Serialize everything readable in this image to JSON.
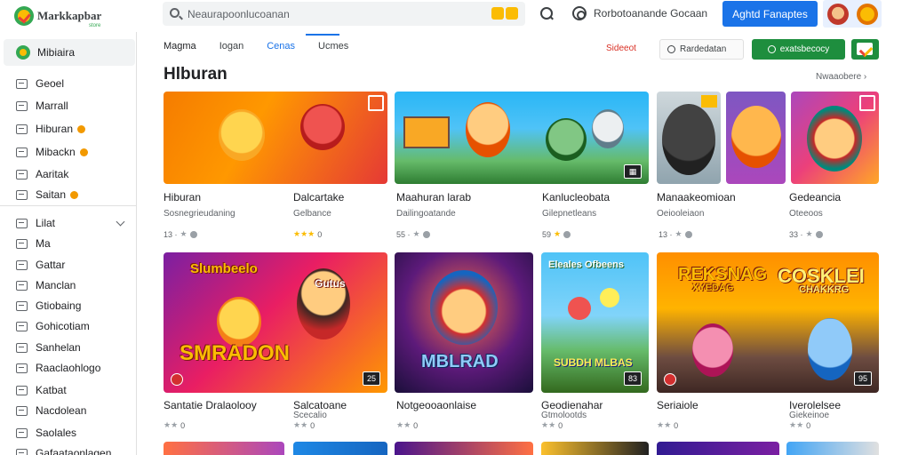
{
  "topbar": {
    "logo_text": "Markkapbar",
    "logo_sub": "store",
    "search_placeholder": "Neaurapoonlucoanan",
    "help_text": "Rorbotoanande Gocaan",
    "signin_label": "Aghtd Fanaptes"
  },
  "sidebar": {
    "home_label": "Mibiaira",
    "items": [
      {
        "label": "Geoel",
        "dot": false
      },
      {
        "label": "Marrall",
        "dot": false
      },
      {
        "label": "Hiburan",
        "dot": true
      },
      {
        "label": "Mibackn",
        "dot": true
      },
      {
        "label": "Aaritak",
        "dot": false
      },
      {
        "label": "Saitan",
        "dot": true
      }
    ],
    "items2": [
      {
        "label": "Lilat"
      },
      {
        "label": "Ma"
      },
      {
        "label": "Gattar"
      },
      {
        "label": "Manclan"
      },
      {
        "label": "Gtiobaing"
      },
      {
        "label": "Gohicotiam"
      },
      {
        "label": "Sanhelan"
      },
      {
        "label": "Raaclaohlogo"
      },
      {
        "label": "Katbat"
      },
      {
        "label": "Nacdolean"
      },
      {
        "label": "Saolales"
      },
      {
        "label": "Gafaataonlagen"
      }
    ]
  },
  "tabs": [
    "Magma",
    "Iogan",
    "Cenas",
    "Ucmes"
  ],
  "actions": {
    "select_link": "Sideeot",
    "filter_label": "Rardedatan",
    "install_label": "exatsbecocy"
  },
  "section": {
    "title": "Hlburan",
    "see_more": "Nwaaobere"
  },
  "row1": [
    {
      "title": "Hiburan",
      "sub": "Sosnegrieudaning",
      "rating": "13 ·"
    },
    {
      "title": "Dalcartake",
      "sub": "Gelbance",
      "rating": "0"
    },
    {
      "title": "Maahuran larab",
      "sub": "Dailingoatande",
      "rating": "55 ·"
    },
    {
      "title": "Kanlucleobata",
      "sub": "Gilepnetleans",
      "rating": "59"
    },
    {
      "title": "Manaakeomioan",
      "sub": "Oeiooleiaon",
      "rating": "13 ·"
    },
    {
      "title": "Gedeancia",
      "sub": "Oteeoos",
      "rating": "33 ·"
    }
  ],
  "row2": [
    {
      "title": "Santatie Dralaolooy",
      "rating": "0",
      "art": "SMRADON",
      "art_top": "Slumbeelo",
      "badge": "25"
    },
    {
      "title": "Salcatoane",
      "sub": "Scecalio",
      "rating": "0",
      "art_top": "Gutus"
    },
    {
      "title": "Notgeooaonlaise",
      "rating": "0",
      "art": "MBLRAD"
    },
    {
      "title": "Geodienahar",
      "sub": "Gtmolootds",
      "rating": "0",
      "art": "SUBDH MLBAS",
      "art_top": "Eleales Ofbeens",
      "badge": "83"
    },
    {
      "title": "Seriaiole",
      "rating": "0",
      "art": "REKSNAG",
      "art_sub": "XYEDAG"
    },
    {
      "title": "Iverolelsee",
      "sub": "Giekeinoe",
      "rating": "0",
      "art": "COSKLEI",
      "art_sub": "CHAKKRG",
      "badge": "95"
    }
  ],
  "colors": {
    "accent": "#1a73e8",
    "install": "#1e8e3e",
    "star": "#fbbc04"
  }
}
